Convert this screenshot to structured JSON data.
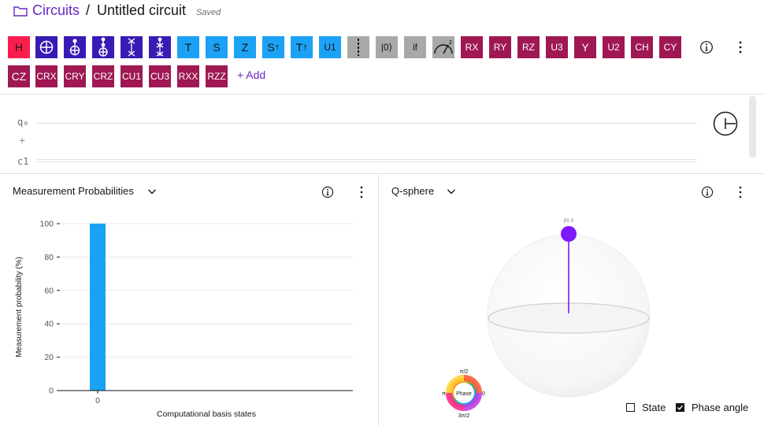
{
  "header": {
    "breadcrumb_link": "Circuits",
    "separator": "/",
    "title": "Untitled circuit",
    "status": "Saved"
  },
  "palette": {
    "gates": {
      "h": "H",
      "t": "T",
      "s": "S",
      "z": "Z",
      "sdg": "S",
      "tdg": "T",
      "dagger": "†",
      "u1": "U1",
      "reset": "|0⟩",
      "if": "if",
      "rx": "RX",
      "ry": "RY",
      "rz": "RZ",
      "u3": "U3",
      "y": "Y",
      "u2": "U2",
      "ch": "CH",
      "cy": "CY",
      "cz": "CZ",
      "crx": "CRX",
      "cry": "CRY",
      "crz": "CRZ",
      "cu1": "CU1",
      "cu3": "CU3",
      "rxx": "RXX",
      "rzz": "RZZ"
    },
    "add_label": "+ Add",
    "icons": [
      "oplus-icon",
      "cnot-icon",
      "toffoli-icon",
      "swap-icon",
      "cswap-icon",
      "barrier-icon",
      "measure-icon",
      "info-icon",
      "more-icon"
    ]
  },
  "circuit": {
    "qubit_label": "q₀",
    "add_qubit": "+",
    "classical_label": "c1"
  },
  "probabilities_panel": {
    "title": "Measurement Probabilities",
    "chart_data": {
      "type": "bar",
      "categories": [
        "0"
      ],
      "values": [
        100
      ],
      "xlabel": "Computational basis states",
      "ylabel": "Measurement probability (%)",
      "ylim": [
        0,
        100
      ],
      "yticks": [
        "0",
        "20",
        "40",
        "60",
        "80",
        "100"
      ],
      "bar_color": "#1ba2f5"
    }
  },
  "qsphere_panel": {
    "title": "Q-sphere",
    "state_label": "|0⟩ 0",
    "phase_wheel": {
      "center": "Phase",
      "top": "π/2",
      "bottom": "3π/2",
      "left": "π",
      "right": "0"
    },
    "legend": {
      "state": "State",
      "state_checked": false,
      "phase": "Phase angle",
      "phase_checked": true
    },
    "state_color": "#7d19ff"
  },
  "colors": {
    "accent": "#6929c4",
    "gate_h": "#fa1e4d",
    "gate_navy": "#3a1ab5",
    "gate_cyan": "#1ba2f5",
    "gate_gray": "#a8a8a8",
    "gate_wine": "#9f1853"
  }
}
